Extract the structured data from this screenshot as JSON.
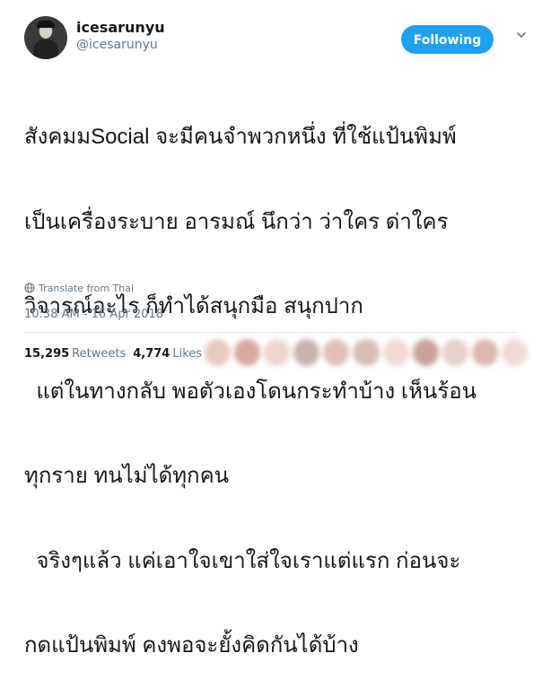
{
  "user": {
    "display_name": "icesarunyu",
    "handle": "@icesarunyu",
    "avatar_icon": "user-avatar"
  },
  "follow_button": {
    "label": "Following",
    "color": "#1da1f2"
  },
  "more_menu": {
    "icon": "chevron-down-icon"
  },
  "tweet": {
    "lines": [
      "สังคมมSocial จะมีคนจำพวกหนึ่ง ที่ใช้แป้นพิมพ์",
      "เป็นเครื่องระบาย อารมณ์ นึกว่า ว่าใคร ด่าใคร",
      "วิจารณ์อะไร ก็ทำได้สนุกมือ สนุกปาก",
      "  แต่ในทางกลับ พอตัวเองโดนกระทำบ้าง เห็นร้อน",
      "ทุกราย ทนไม่ได้ทุกคน",
      "  จริงๆแล้ว แค่เอาใจเขาใส่ใจเราแต่แรก ก่อนจะ",
      "กดแป้นพิมพ์ คงพอจะยั้งคิดกันได้บ้าง"
    ]
  },
  "translate": {
    "label": "Translate from Thai",
    "icon": "globe-icon"
  },
  "timestamp": "10:38 AM - 16 Apr 2018",
  "stats": {
    "retweets_count": "15,295",
    "retweets_label": "Retweets",
    "likes_count": "4,774",
    "likes_label": "Likes"
  },
  "liker_avatar_colors": [
    "#e8c9c2",
    "#d9a79e",
    "#f0d3d0",
    "#c7b3b0",
    "#e3c0bd",
    "#d9bcb8",
    "#f2d9d6",
    "#caa29d",
    "#e6cfcc",
    "#dcb7b2",
    "#efdad7"
  ]
}
